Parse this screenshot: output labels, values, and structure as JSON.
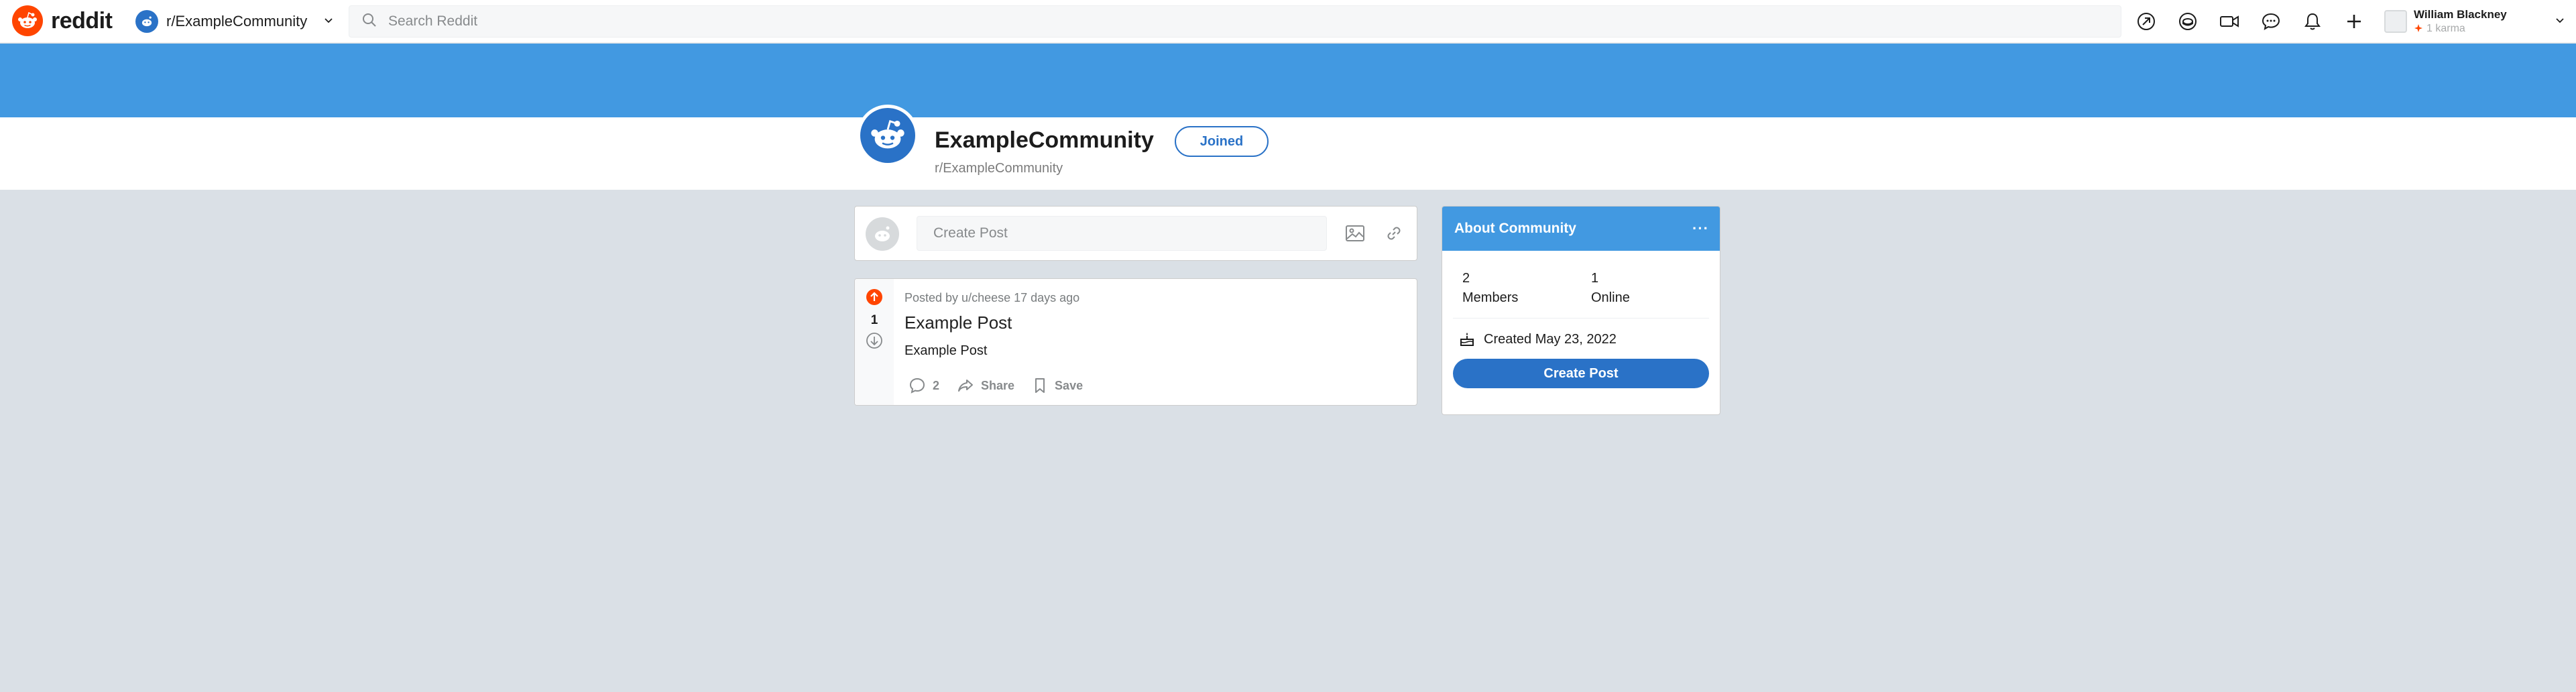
{
  "header": {
    "logo_text": "reddit",
    "community_switcher": "r/ExampleCommunity",
    "search_placeholder": "Search Reddit",
    "icons": [
      "popular-icon",
      "coin-icon",
      "video-icon",
      "chat-icon",
      "bell-icon",
      "plus-icon"
    ],
    "user": {
      "name": "William Blackney",
      "karma": "1 karma"
    }
  },
  "community": {
    "title": "ExampleCommunity",
    "subtitle": "r/ExampleCommunity",
    "join_button": "Joined"
  },
  "create_post": {
    "placeholder": "Create Post"
  },
  "posts": [
    {
      "votes": "1",
      "meta": "Posted by u/cheese 17 days ago",
      "title": "Example Post",
      "body": "Example Post",
      "comments": "2",
      "share": "Share",
      "save": "Save"
    }
  ],
  "about": {
    "title": "About Community",
    "more": "···",
    "members_count": "2",
    "members_label": "Members",
    "online_count": "1",
    "online_label": "Online",
    "created": "Created May 23, 2022",
    "create_button": "Create Post"
  },
  "colors": {
    "brand": "#ff4500",
    "accent_blue": "#2a72c7",
    "banner": "#4299e1",
    "background": "#dae0e6"
  }
}
